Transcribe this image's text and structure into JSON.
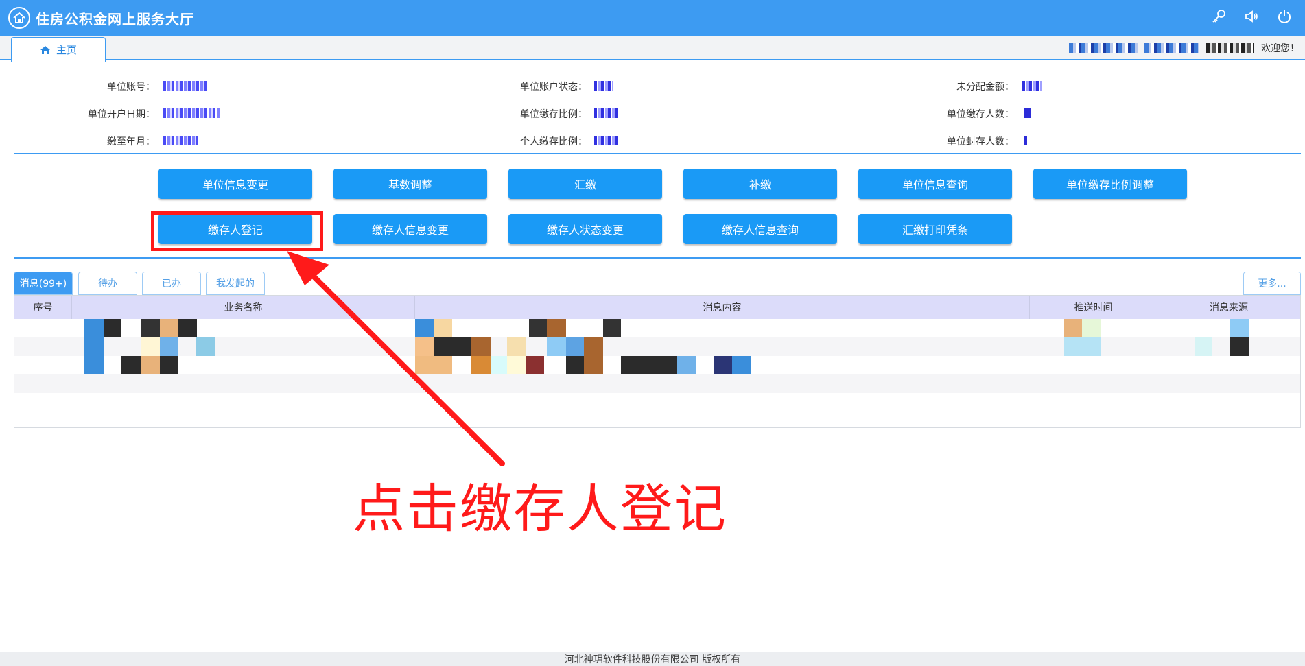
{
  "header": {
    "title": "住房公积金网上服务大厅",
    "icons": [
      "key-icon",
      "speaker-icon",
      "power-icon"
    ]
  },
  "tabbar": {
    "home_label": "主页",
    "welcome": "欢迎您！"
  },
  "info": {
    "unit_account_label": "单位账号：",
    "unit_open_date_label": "单位开户日期：",
    "paid_to_label": "缴至年月：",
    "account_status_label": "单位账户状态：",
    "unit_ratio_label": "单位缴存比例：",
    "personal_ratio_label": "个人缴存比例：",
    "unallocated_label": "未分配金额：",
    "depositors_label": "单位缴存人数：",
    "sealed_label": "单位封存人数："
  },
  "actions": {
    "row1": [
      "单位信息变更",
      "基数调整",
      "汇缴",
      "补缴",
      "单位信息查询",
      "单位缴存比例调整"
    ],
    "row2": [
      "缴存人登记",
      "缴存人信息变更",
      "缴存人状态变更",
      "缴存人信息查询",
      "汇缴打印凭条"
    ]
  },
  "messages": {
    "tabs": [
      "消息(99+)",
      "待办",
      "已办",
      "我发起的"
    ],
    "more": "更多...",
    "columns": [
      "序号",
      "业务名称",
      "消息内容",
      "推送时间",
      "消息来源"
    ]
  },
  "annotation": {
    "text": "点击缴存人登记",
    "color": "#ff1a1a"
  },
  "footer": {
    "copyright": "河北神玥软件科技股份有限公司 版权所有"
  },
  "colors": {
    "primary": "#3d9bf2",
    "button": "#1a9af6",
    "table_header": "#dcdcfa"
  }
}
